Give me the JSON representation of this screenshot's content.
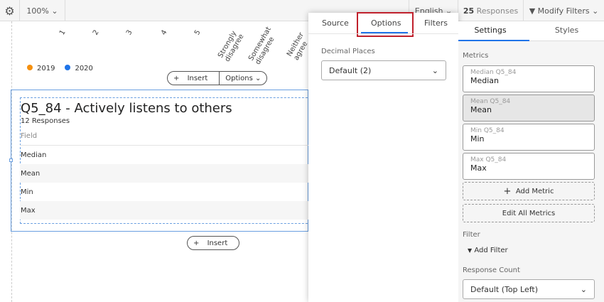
{
  "topbar": {
    "zoom": "100%",
    "language": "English",
    "responses_count": "25",
    "responses_label": "Responses",
    "modify_filters": "Modify Filters"
  },
  "chart": {
    "x_labels": [
      "1",
      "2",
      "3",
      "4",
      "5",
      "Strongly disagree",
      "Somewhat disagree",
      "Neither agree ..."
    ],
    "legend": [
      {
        "label": "2019",
        "color": "#f5900f"
      },
      {
        "label": "2020",
        "color": "#1f74e8"
      }
    ]
  },
  "toolbar": {
    "insert": "Insert",
    "options": "Options"
  },
  "widget": {
    "title": "Q5_84 - Actively listens to others",
    "responses": "12 Responses",
    "column_header": "Field",
    "rows": [
      "Median",
      "Mean",
      "Min",
      "Max"
    ],
    "insert": "Insert"
  },
  "popup": {
    "tabs": [
      "Source",
      "Options",
      "Filters"
    ],
    "decimal_label": "Decimal Places",
    "decimal_value": "Default (2)"
  },
  "panel": {
    "tabs": [
      "Settings",
      "Styles"
    ],
    "metrics_label": "Metrics",
    "metrics": [
      {
        "source": "Median Q5_84",
        "name": "Median"
      },
      {
        "source": "Mean Q5_84",
        "name": "Mean"
      },
      {
        "source": "Min Q5_84",
        "name": "Min"
      },
      {
        "source": "Max Q5_84",
        "name": "Max"
      }
    ],
    "add_metric": "Add Metric",
    "edit_all": "Edit All Metrics",
    "filter_label": "Filter",
    "add_filter": "Add Filter",
    "response_count_label": "Response Count",
    "response_count_value": "Default (Top Left)"
  }
}
